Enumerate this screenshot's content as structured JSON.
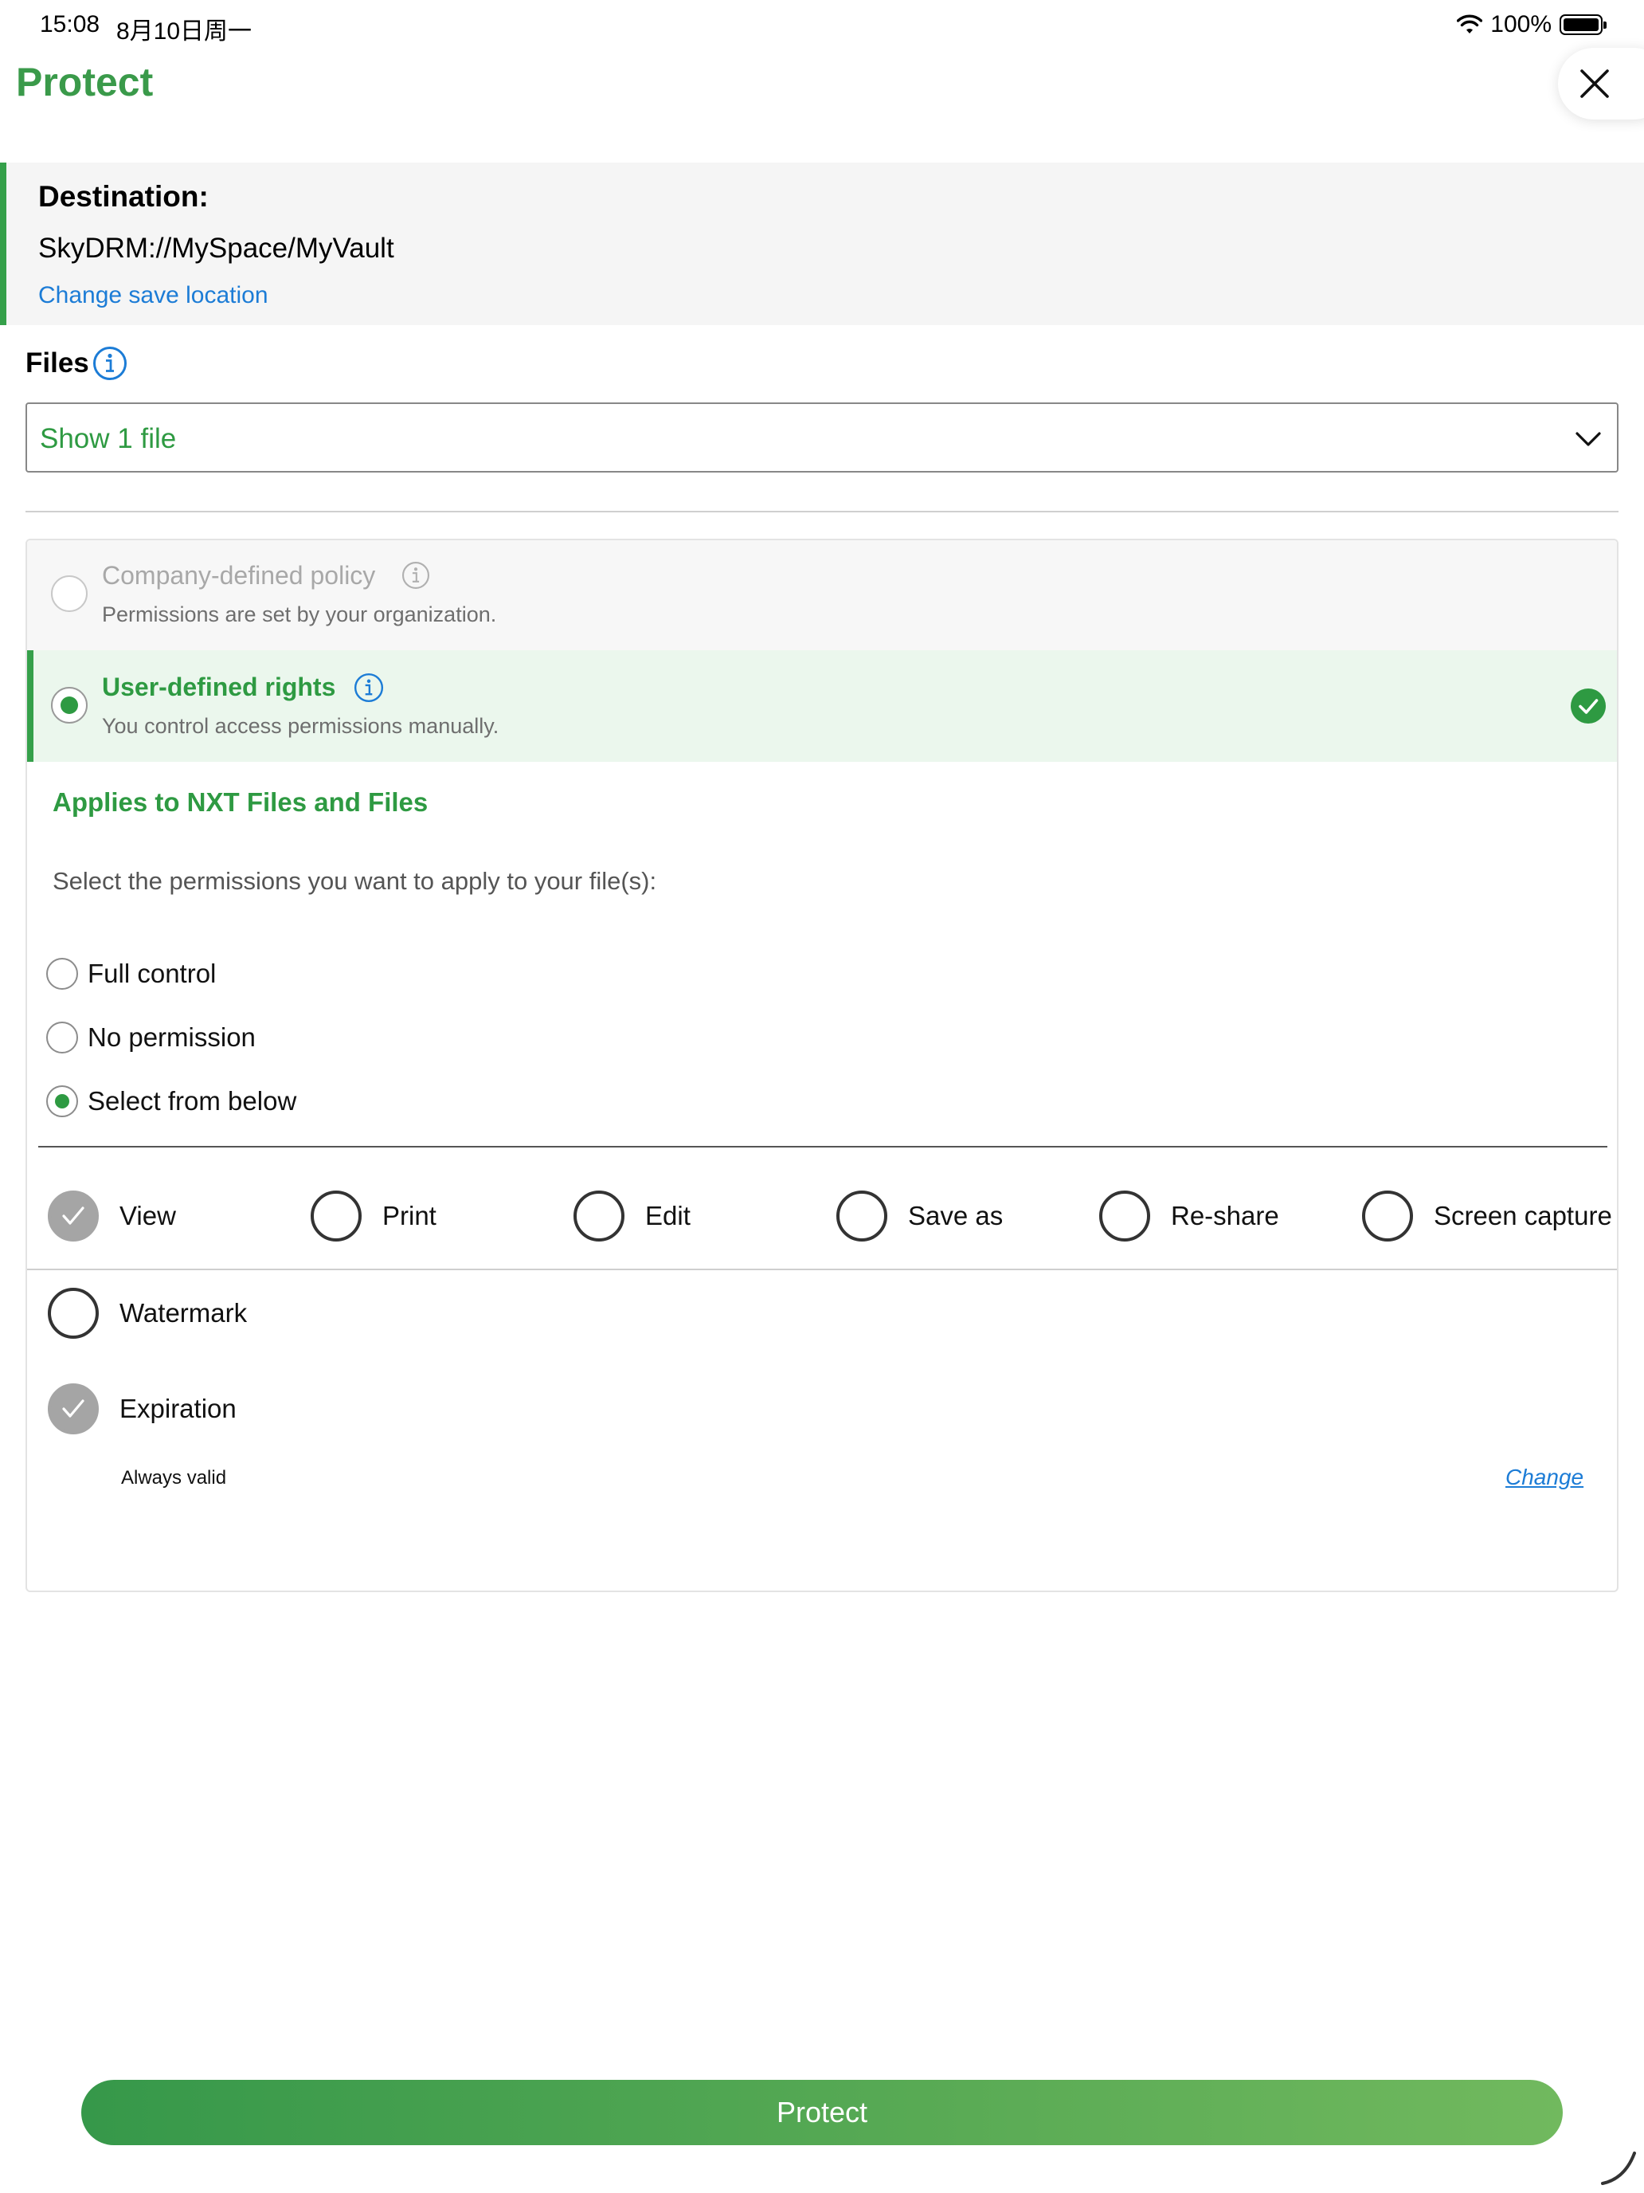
{
  "status_bar": {
    "time": "15:08",
    "date": "8月10日周一",
    "battery": "100%"
  },
  "header": {
    "title": "Protect"
  },
  "destination": {
    "label": "Destination:",
    "path": "SkyDRM://MySpace/MyVault",
    "change_link": "Change save location"
  },
  "files": {
    "label": "Files",
    "dropdown": "Show 1 file"
  },
  "policy": {
    "company": {
      "title": "Company-defined policy",
      "subtitle": "Permissions are set by your organization."
    },
    "user": {
      "title": "User-defined rights",
      "subtitle": "You control access permissions manually."
    }
  },
  "rights": {
    "applies_title": "Applies to NXT Files and Files",
    "instruction": "Select the permissions you want to apply to your file(s):",
    "options": [
      "Full control",
      "No permission",
      "Select from below"
    ],
    "permissions": [
      "View",
      "Print",
      "Edit",
      "Save as",
      "Re-share",
      "Screen capture"
    ],
    "watermark": "Watermark",
    "expiration": "Expiration",
    "expiration_value": "Always valid",
    "change_link": "Change"
  },
  "footer": {
    "protect_button": "Protect"
  },
  "colors": {
    "accent_green": "#2e9a42",
    "link_blue": "#1c7cd6",
    "destination_bg": "#f5f5f5",
    "selected_bg": "#ebf7ed"
  }
}
